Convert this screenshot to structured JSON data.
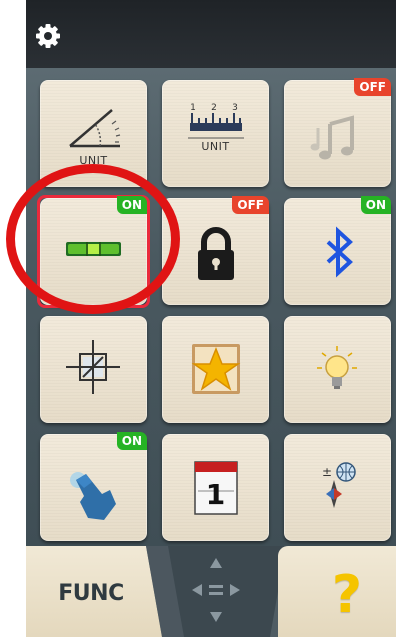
{
  "app": {
    "icons": {
      "settings": "gear-icon",
      "angle": "angle-unit-icon",
      "ruler": "ruler-unit-icon",
      "sound": "music-note-icon",
      "level": "bubble-level-icon",
      "lock": "lock-icon",
      "bluetooth": "bluetooth-icon",
      "crosshair": "crosshair-frame-icon",
      "favorites": "star-icon",
      "light": "light-bulb-icon",
      "touch": "touch-hand-icon",
      "calendar": "calendar-icon",
      "compass": "compass-globe-icon",
      "navigation": "dpad-icon"
    }
  },
  "tiles": {
    "angle_unit": {
      "label": "UNIT"
    },
    "length_unit": {
      "label": "UNIT",
      "scale": [
        "1",
        "2",
        "3"
      ]
    },
    "sound": {
      "status": "OFF"
    },
    "level": {
      "status": "ON"
    },
    "lock": {
      "status": "OFF"
    },
    "bluetooth": {
      "status": "ON"
    },
    "touch": {
      "status": "ON"
    },
    "calendar": {
      "day": "1"
    }
  },
  "bottom_bar": {
    "func_label": "FUNC",
    "help_label": "?"
  },
  "colors": {
    "on_badge": "#26b324",
    "off_badge": "#e8442c",
    "highlight_circle": "#e01414",
    "tile_background": "#efe6d4",
    "screen_background": "#44535b"
  }
}
